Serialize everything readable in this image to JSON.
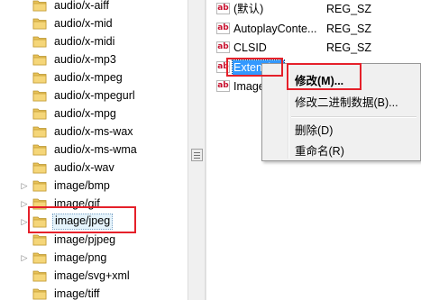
{
  "tree": {
    "items": [
      {
        "label": "audio/x-aiff",
        "expandable": false
      },
      {
        "label": "audio/x-mid",
        "expandable": false
      },
      {
        "label": "audio/x-midi",
        "expandable": false
      },
      {
        "label": "audio/x-mp3",
        "expandable": false
      },
      {
        "label": "audio/x-mpeg",
        "expandable": false
      },
      {
        "label": "audio/x-mpegurl",
        "expandable": false
      },
      {
        "label": "audio/x-mpg",
        "expandable": false
      },
      {
        "label": "audio/x-ms-wax",
        "expandable": false
      },
      {
        "label": "audio/x-ms-wma",
        "expandable": false
      },
      {
        "label": "audio/x-wav",
        "expandable": false
      },
      {
        "label": "image/bmp",
        "expandable": true
      },
      {
        "label": "image/gif",
        "expandable": true
      },
      {
        "label": "image/jpeg",
        "expandable": true,
        "selected": true
      },
      {
        "label": "image/pjpeg",
        "expandable": false
      },
      {
        "label": "image/png",
        "expandable": true
      },
      {
        "label": "image/svg+xml",
        "expandable": false
      },
      {
        "label": "image/tiff",
        "expandable": false
      }
    ]
  },
  "values": {
    "rows": [
      {
        "name": "(默认)",
        "type": "REG_SZ"
      },
      {
        "name": "AutoplayConte...",
        "type": "REG_SZ"
      },
      {
        "name": "CLSID",
        "type": "REG_SZ"
      },
      {
        "name": "Extension",
        "type": "REG_SZ",
        "selected": true
      },
      {
        "name": "Image",
        "type": ""
      }
    ]
  },
  "context_menu": {
    "items": [
      {
        "label": "修改(M)...",
        "bold": true
      },
      {
        "label": "修改二进制数据(B)...",
        "bold": false
      },
      {
        "separator": true
      },
      {
        "label": "删除(D)",
        "bold": false
      },
      {
        "label": "重命名(R)",
        "bold": false
      }
    ]
  },
  "colors": {
    "highlight_box": "#e5202a",
    "selection": "#3399ff",
    "folder": "#e8c25a"
  },
  "icons": {
    "folder": "folder-icon",
    "string_value": "string-value-icon",
    "expander": "expander-arrow-icon"
  }
}
